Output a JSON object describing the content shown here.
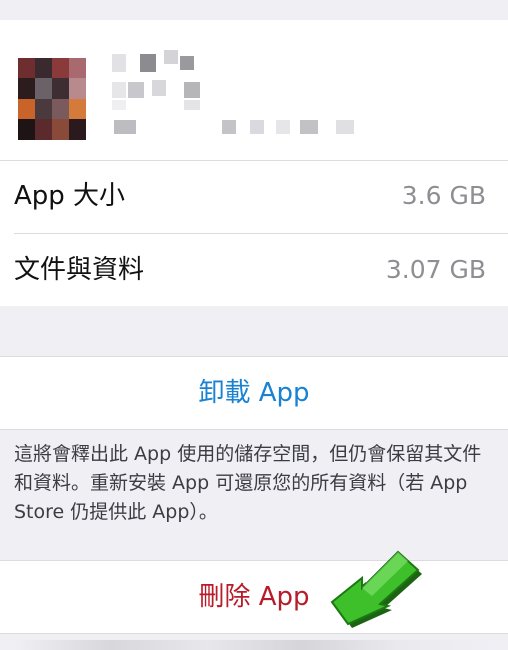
{
  "app_info": {
    "icon_name": "app-icon-pixelated",
    "name_redacted": true
  },
  "rows": [
    {
      "label": "App 大小",
      "value": "3.6 GB"
    },
    {
      "label": "文件與資料",
      "value": "3.07 GB"
    }
  ],
  "offload": {
    "label": "卸載 App",
    "color": "#1a82d2",
    "description": "這將會釋出此 App 使用的儲存空間，但仍會保留其文件和資料。重新安裝 App 可還原您的所有資料（若 App Store 仍提供此 App）。"
  },
  "delete": {
    "label": "刪除 App",
    "color": "#b81c2a"
  },
  "annotation": {
    "icon_name": "green-arrow-icon",
    "color": "#2faa1f"
  }
}
